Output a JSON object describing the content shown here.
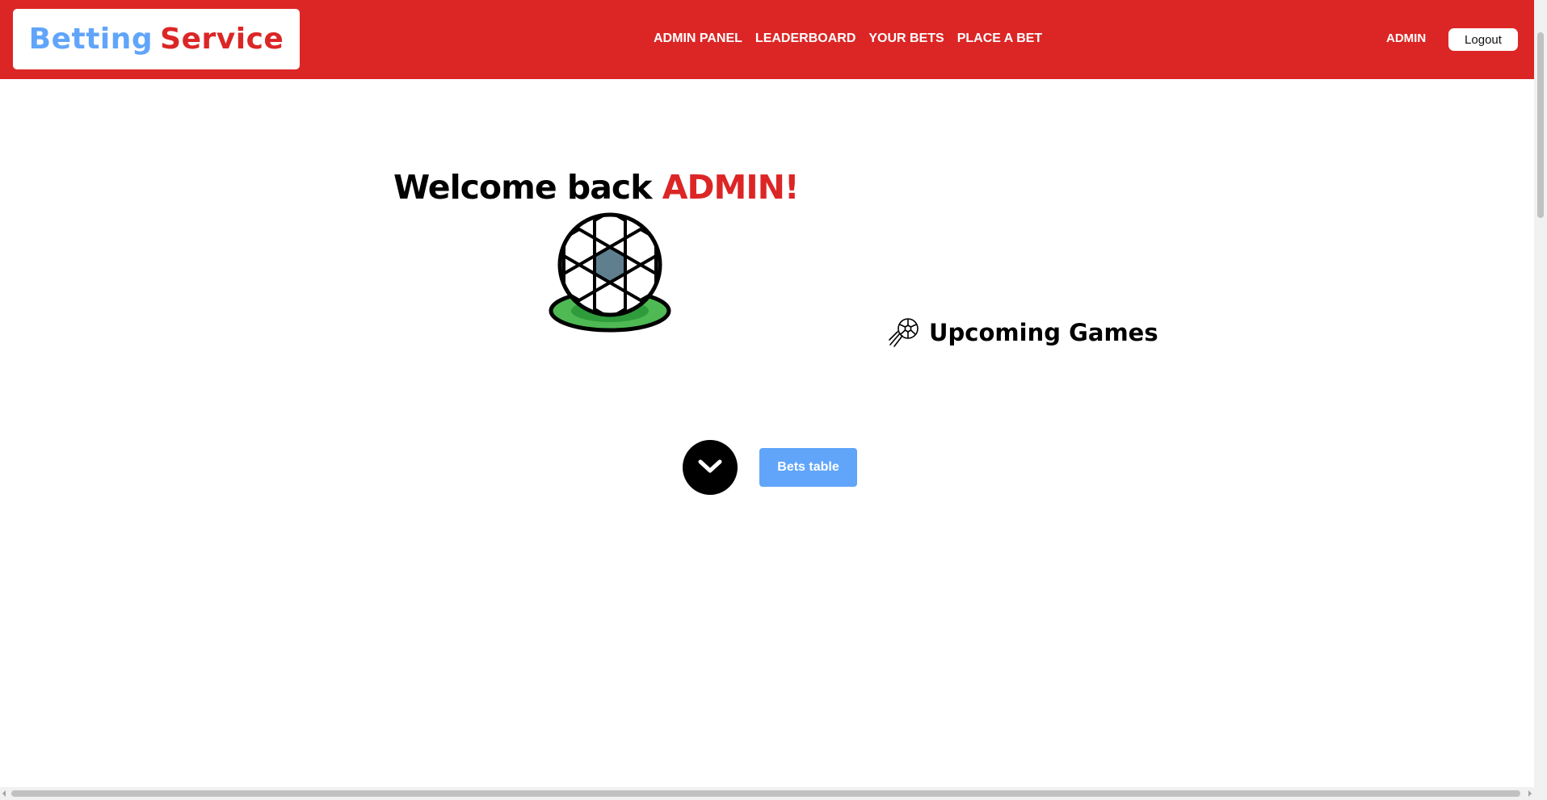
{
  "brand": {
    "part1": "Betting",
    "part2": "Service"
  },
  "nav": {
    "links": [
      "ADMIN PANEL",
      "LEADERBOARD",
      "YOUR BETS",
      "PLACE A BET"
    ],
    "user": "ADMIN",
    "logout_label": "Logout"
  },
  "main": {
    "welcome_prefix": "Welcome back",
    "welcome_name": "ADMIN!",
    "upcoming_title": "Upcoming Games",
    "bets_table_label": "Bets table"
  },
  "colors": {
    "navbar": "#dc2626",
    "brand_blue": "#60a5fa",
    "brand_red": "#dc2626",
    "button_blue": "#60a5fa"
  },
  "icons": {
    "hero": "soccer-ball-icon",
    "upcoming": "soccer-ball-kick-icon",
    "scroll": "chevron-down-icon"
  }
}
